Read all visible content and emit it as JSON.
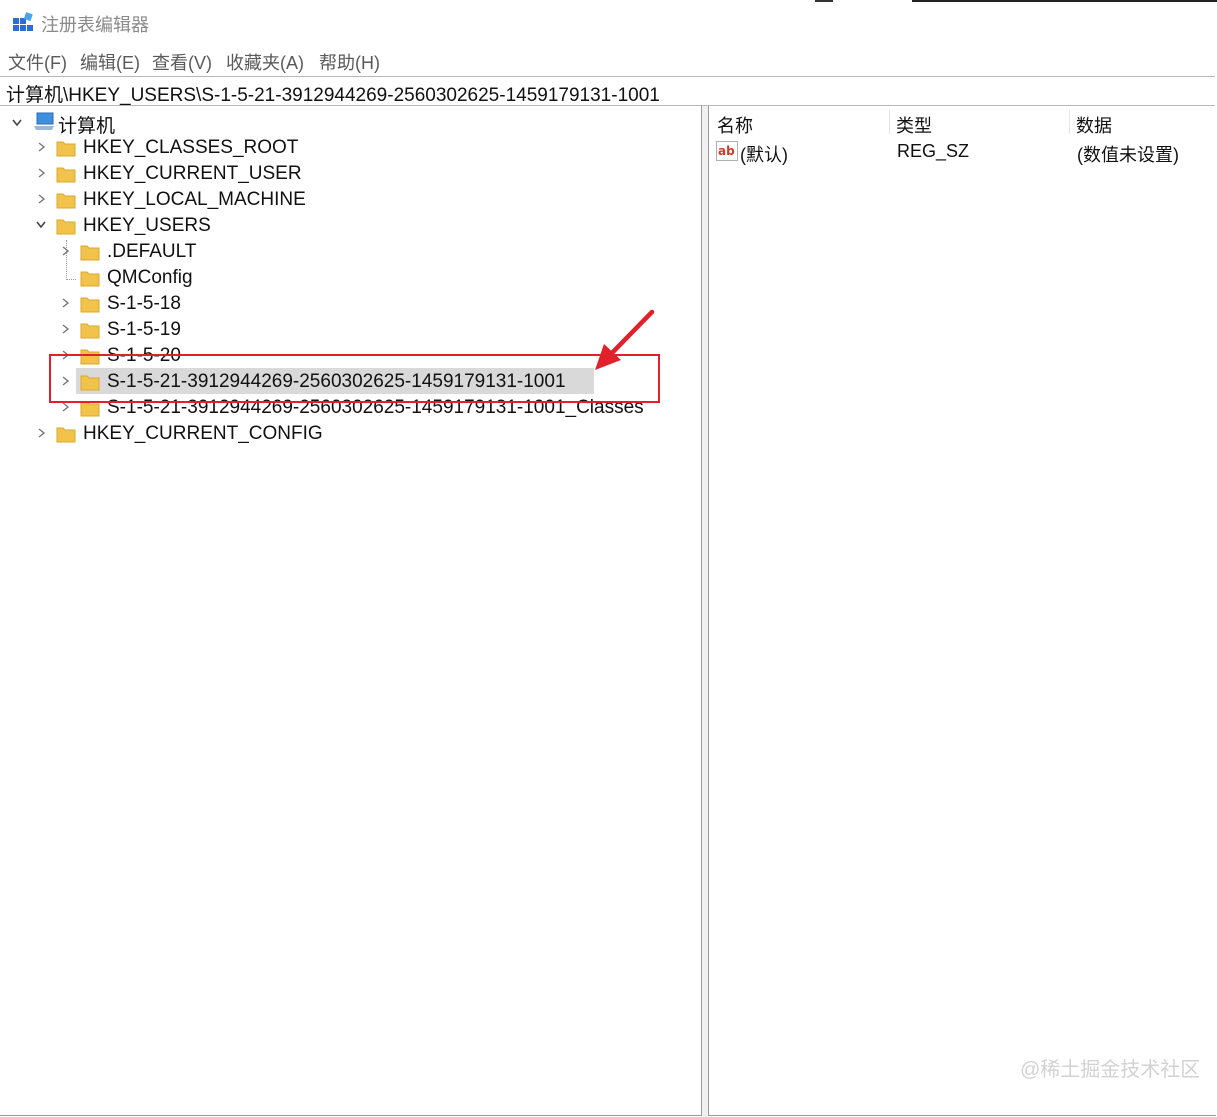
{
  "window": {
    "title": "注册表编辑器"
  },
  "menu": [
    "文件(F)",
    "编辑(E)",
    "查看(V)",
    "收藏夹(A)",
    "帮助(H)"
  ],
  "address": "计算机\\HKEY_USERS\\S-1-5-21-3912944269-2560302625-1459179131-1001",
  "tree": {
    "root": "计算机",
    "hives": [
      "HKEY_CLASSES_ROOT",
      "HKEY_CURRENT_USER",
      "HKEY_LOCAL_MACHINE",
      "HKEY_USERS",
      "HKEY_CURRENT_CONFIG"
    ],
    "users_children": [
      ".DEFAULT",
      "QMConfig",
      "S-1-5-18",
      "S-1-5-19",
      "S-1-5-20",
      "S-1-5-21-3912944269-2560302625-1459179131-1001",
      "S-1-5-21-3912944269-2560302625-1459179131-1001_Classes"
    ],
    "selected": "S-1-5-21-3912944269-2560302625-1459179131-1001"
  },
  "values_list": {
    "columns": [
      "名称",
      "类型",
      "数据"
    ],
    "rows": [
      {
        "name": "(默认)",
        "type": "REG_SZ",
        "data": "(数值未设置)",
        "icon": "string-value-ab-icon"
      }
    ]
  },
  "watermark": "@稀土掘金技术社区",
  "colors": {
    "annotation": "#e0212b",
    "folder": "#f2c34b",
    "selection": "#d9d9d9"
  }
}
